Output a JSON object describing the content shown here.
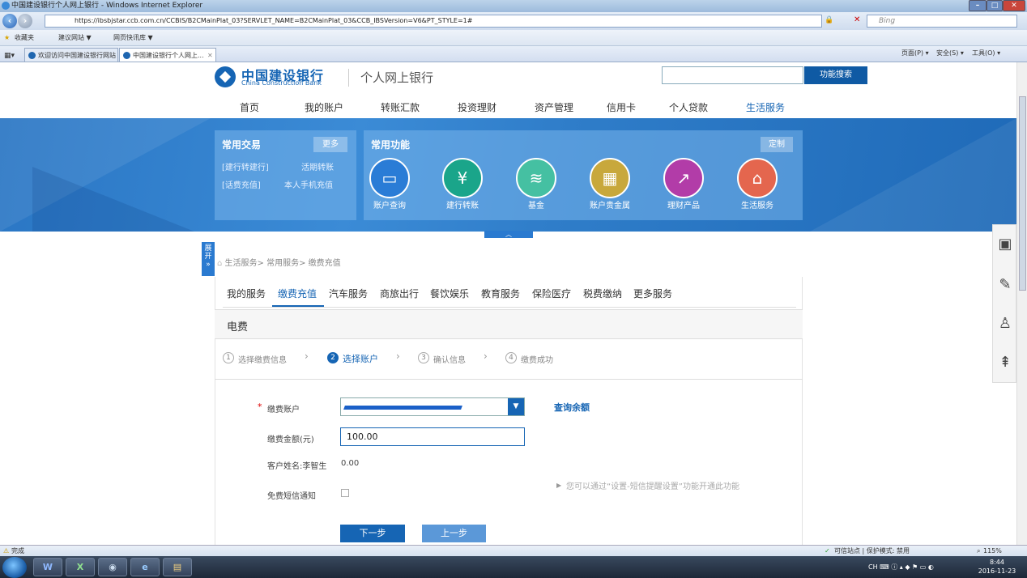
{
  "window": {
    "title": "中国建设银行个人网上银行 - Windows Internet Explorer",
    "min": "–",
    "max": "□",
    "close": "✕"
  },
  "browser": {
    "url": "https://ibsbjstar.ccb.com.cn/CCBIS/B2CMainPlat_03?SERVLET_NAME=B2CMainPlat_03&CCB_IBSVersion=V6&PT_STYLE=1#",
    "search_placeholder": "Bing",
    "favorites_label": "收藏夹",
    "fav_links": [
      "建议网站 ▼",
      "网页快讯库 ▼"
    ],
    "tabs": [
      "欢迎访问中国建设银行网站",
      "中国建设银行个人网上..."
    ],
    "tab_close": "✕",
    "toolbar_right": [
      "页面(P) ▾",
      "安全(S) ▾",
      "工具(O) ▾"
    ],
    "status_left": "完成",
    "status_mid": "可信站点 | 保护模式: 禁用",
    "zoom": "115%"
  },
  "bank": {
    "logo_cn": "中国建设银行",
    "logo_en": "China Construction Bank",
    "logo_sub": "个人网上银行",
    "search_button": "功能搜索",
    "nav": [
      "首页",
      "我的账户",
      "转账汇款",
      "投资理财",
      "资产管理",
      "信用卡",
      "个人贷款",
      "生活服务"
    ],
    "common_tx": {
      "title": "常用交易",
      "more": "更多",
      "links": [
        "[建行转建行]",
        "活期转账",
        "[话费充值]",
        "本人手机充值"
      ]
    },
    "common_fn": {
      "title": "常用功能",
      "customize": "定制",
      "items": [
        {
          "label": "账户查询",
          "color": "#2a7cd6",
          "icon": "card-search-icon"
        },
        {
          "label": "建行转账",
          "color": "#1aa58a",
          "icon": "yuan-transfer-icon"
        },
        {
          "label": "基金",
          "color": "#45c0a2",
          "icon": "coins-icon"
        },
        {
          "label": "账户贵金属",
          "color": "#c8a83c",
          "icon": "gold-bars-icon"
        },
        {
          "label": "理财产品",
          "color": "#b23ca8",
          "icon": "chart-up-icon"
        },
        {
          "label": "生活服务",
          "color": "#e4664e",
          "icon": "house-icon"
        }
      ]
    },
    "expand_label": "展开",
    "breadcrumb": "生活服务> 常用服务> 缴费充值",
    "sub_tabs": [
      "我的服务",
      "缴费充值",
      "汽车服务",
      "商旅出行",
      "餐饮娱乐",
      "教育服务",
      "保险医疗",
      "税费缴纳",
      "更多服务"
    ],
    "section_title": "电费",
    "steps": [
      {
        "num": "1",
        "label": "选择缴费信息"
      },
      {
        "num": "2",
        "label": "选择账户"
      },
      {
        "num": "3",
        "label": "确认信息"
      },
      {
        "num": "4",
        "label": "缴费成功"
      }
    ],
    "form": {
      "required_mark": "*",
      "account_label": "缴费账户",
      "balance_link": "查询余额",
      "amount_label": "缴费金额(元)",
      "amount_value": "100.00",
      "customer_label": "客户姓名:李智生",
      "customer_value": "0.00",
      "sms_label": "免费短信通知",
      "hint": "您可以通过“设置-短信提醒设置”功能开通此功能",
      "next": "下一步",
      "prev": "上一步"
    }
  },
  "taskbar": {
    "time": "8:44",
    "date": "2016-11-23",
    "lang": "CH"
  }
}
